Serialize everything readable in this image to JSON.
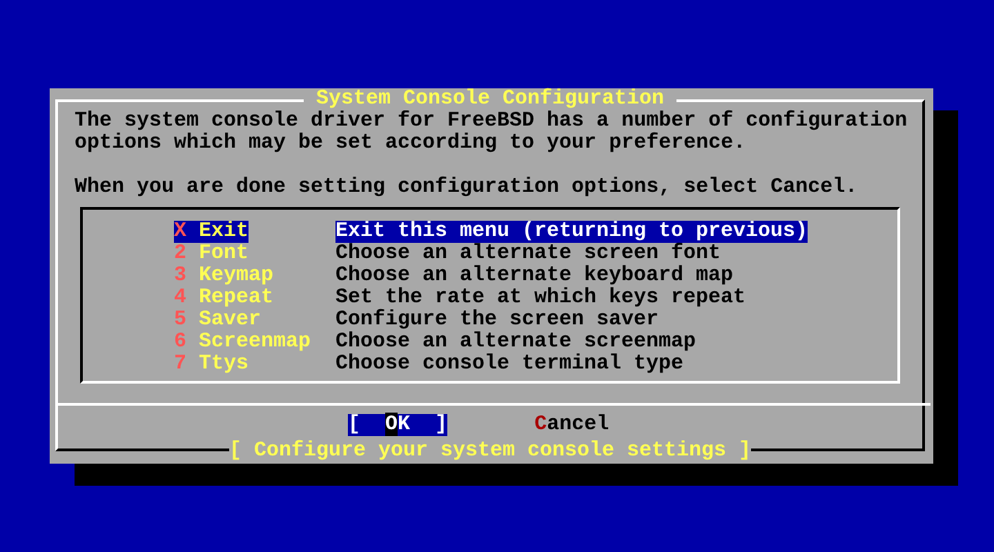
{
  "dialog": {
    "title": "System Console Configuration",
    "paragraphs": [
      [
        "The system console driver for FreeBSD has a number of configuration",
        "options which may be set according to your preference."
      ],
      [
        "When you are done setting configuration options, select Cancel."
      ]
    ],
    "menu": [
      {
        "key": "X",
        "name": "Exit",
        "description": "Exit this menu (returning to previous)",
        "selected": true
      },
      {
        "key": "2",
        "name": "Font",
        "description": "Choose an alternate screen font",
        "selected": false
      },
      {
        "key": "3",
        "name": "Keymap",
        "description": "Choose an alternate keyboard map",
        "selected": false
      },
      {
        "key": "4",
        "name": "Repeat",
        "description": "Set the rate at which keys repeat",
        "selected": false
      },
      {
        "key": "5",
        "name": "Saver",
        "description": "Configure the screen saver",
        "selected": false
      },
      {
        "key": "6",
        "name": "Screenmap",
        "description": "Choose an alternate screenmap",
        "selected": false
      },
      {
        "key": "7",
        "name": "Ttys",
        "description": "Choose console terminal type",
        "selected": false
      }
    ],
    "buttons": [
      {
        "label": "OK",
        "open": "[",
        "close": "]",
        "selected": true
      },
      {
        "label": "Cancel",
        "selected": false
      }
    ],
    "footer": "[ Configure your system console settings ]"
  }
}
